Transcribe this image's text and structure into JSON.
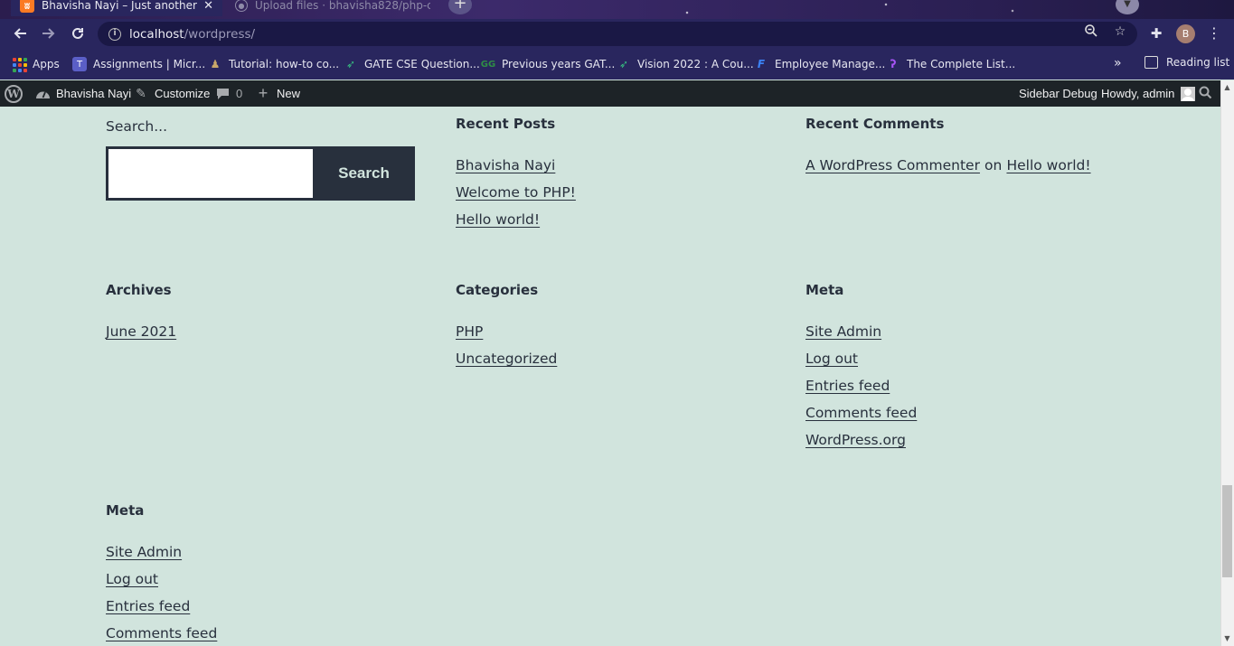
{
  "browser": {
    "tabs": [
      {
        "title": "Bhavisha Nayi – Just another WordPress site",
        "favicon": "xampp-icon",
        "active": true
      },
      {
        "title": "Upload files · bhavisha828/php-c",
        "favicon": "github-icon",
        "active": false
      }
    ],
    "new_tab": "+",
    "url_host": "localhost",
    "url_path": "/wordpress/",
    "profile_initial": "B",
    "bookmarks": [
      {
        "label": "Apps",
        "icon": "apps-grid-icon"
      },
      {
        "label": "Assignments | Micr...",
        "icon": "teams-icon"
      },
      {
        "label": "Tutorial: how-to co...",
        "icon": "bookmark-icon"
      },
      {
        "label": "GATE CSE Question...",
        "icon": "rocket-icon"
      },
      {
        "label": "Previous years GAT...",
        "icon": "gfg-icon"
      },
      {
        "label": "Vision 2022 : A Cou...",
        "icon": "rocket-icon"
      },
      {
        "label": "Employee Manage...",
        "icon": "f-icon"
      },
      {
        "label": "The Complete List...",
        "icon": "hash-icon"
      }
    ],
    "bookmarks_overflow": "»",
    "reading_list": "Reading list"
  },
  "adminbar": {
    "site_name": "Bhavisha Nayi",
    "customize": "Customize",
    "comments_count": "0",
    "new": "New",
    "sidebar_debug": "Sidebar Debug",
    "howdy": "Howdy, admin"
  },
  "widgets": {
    "search": {
      "label": "Search...",
      "button": "Search",
      "value": ""
    },
    "recent_posts": {
      "title": "Recent Posts",
      "items": [
        "Bhavisha Nayi",
        "Welcome to PHP!",
        "Hello world!"
      ]
    },
    "recent_comments": {
      "title": "Recent Comments",
      "author": "A WordPress Commenter",
      "on": "on",
      "post": "Hello world!"
    },
    "archives": {
      "title": "Archives",
      "items": [
        "June 2021"
      ]
    },
    "categories": {
      "title": "Categories",
      "items": [
        "PHP",
        "Uncategorized"
      ]
    },
    "meta": {
      "title": "Meta",
      "items": [
        "Site Admin",
        "Log out",
        "Entries feed",
        "Comments feed",
        "WordPress.org"
      ]
    },
    "meta2": {
      "title": "Meta",
      "items": [
        "Site Admin",
        "Log out",
        "Entries feed",
        "Comments feed"
      ]
    }
  },
  "colors": {
    "page_bg": "#d1e4dd",
    "text": "#28303d",
    "adminbar_bg": "#1d2327",
    "browser_chrome": "#29265e"
  }
}
